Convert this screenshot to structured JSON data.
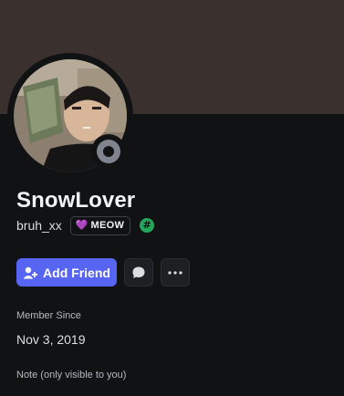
{
  "profile": {
    "display_name": "SnowLover",
    "username": "bruh_xx",
    "tag_heart": "💜",
    "tag_text": "MEOW",
    "hash_badge": "#"
  },
  "actions": {
    "add_friend_label": "Add Friend",
    "message_icon": "speech-bubble-icon",
    "more_icon": "more-dots-icon",
    "more_glyph": "···"
  },
  "sections": {
    "member_since_label": "Member Since",
    "member_since_value": "Nov 3, 2019",
    "note_label": "Note (only visible to you)"
  },
  "colors": {
    "banner": "#3a302e",
    "background": "#111214",
    "accent": "#5865f2",
    "status_offline": "#80848e",
    "badge_green": "#23a55a"
  }
}
